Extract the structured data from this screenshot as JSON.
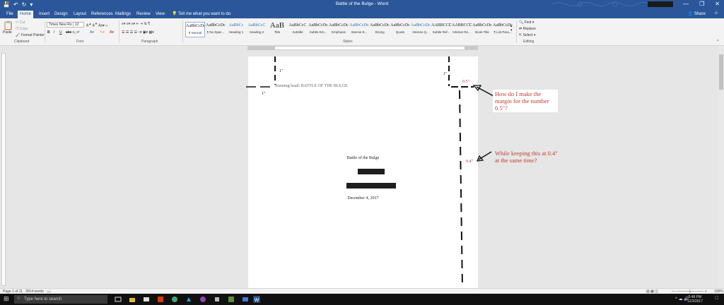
{
  "window": {
    "title": "Battle of the Bulge  -  Word",
    "controls": [
      "—",
      "❐",
      "✕"
    ]
  },
  "tabs": [
    "File",
    "Home",
    "Insert",
    "Design",
    "Layout",
    "References",
    "Mailings",
    "Review",
    "View"
  ],
  "tell_me": "Tell me what you want to do",
  "share": "Share",
  "ribbon": {
    "clipboard": {
      "paste": "Paste",
      "cut": "Cut",
      "copy": "Copy",
      "format_painter": "Format Painter",
      "label": "Clipboard"
    },
    "font": {
      "name": "Times New Ro",
      "size": "12",
      "label": "Font"
    },
    "paragraph": {
      "label": "Paragraph"
    },
    "styles": {
      "label": "Styles",
      "items": [
        {
          "sample": "AaBbCcDc",
          "name": "¶ Normal"
        },
        {
          "sample": "AaBbCcDc",
          "name": "¶ No Spac..."
        },
        {
          "sample": "AaBbCc",
          "name": "Heading 1"
        },
        {
          "sample": "AaBbCcC",
          "name": "Heading 2"
        },
        {
          "sample": "AaB",
          "name": "Title"
        },
        {
          "sample": "AaBbCcC",
          "name": "Subtitle"
        },
        {
          "sample": "AaBbCcDc",
          "name": "Subtle Em..."
        },
        {
          "sample": "AaBbCcDc",
          "name": "Emphasis"
        },
        {
          "sample": "AaBbCcDc",
          "name": "Intense E..."
        },
        {
          "sample": "AaBbCcDc",
          "name": "Strong"
        },
        {
          "sample": "AaBbCcDc",
          "name": "Quote"
        },
        {
          "sample": "AaBbCcDc",
          "name": "Intense Q..."
        },
        {
          "sample": "AABBCCDC",
          "name": "Subtle Ref..."
        },
        {
          "sample": "AABBCCDC",
          "name": "Intense Re..."
        },
        {
          "sample": "AaBbCcDc",
          "name": "Book Title"
        },
        {
          "sample": "AaBbCcDc",
          "name": "¶ List Para..."
        }
      ]
    },
    "editing": {
      "find": "Find",
      "replace": "Replace",
      "select": "Select",
      "label": "Editing"
    }
  },
  "document": {
    "running_head": "Running head: BATTLE OF THE BULGE",
    "title": "Battle of the Bulge",
    "date": "December 4, 2017",
    "margin_top_left": "1\"",
    "margin_left": "1\"",
    "margin_top_right": "1\"",
    "header_right": "0.5\"",
    "right_side": "0.4\""
  },
  "annotations": {
    "q1": "How do I make the margin for the number 0.5\"?",
    "q2": "While keeping this at 0.4\" at the same time?"
  },
  "status": {
    "page": "Page 1 of 11",
    "words": "3014 words",
    "zoom": "100%"
  },
  "taskbar": {
    "search": "Type here to search",
    "time": "5:48 PM",
    "date": "12/3/2017"
  },
  "colors": {
    "word_blue": "#2b579a",
    "annotation_red": "#c0392b"
  }
}
